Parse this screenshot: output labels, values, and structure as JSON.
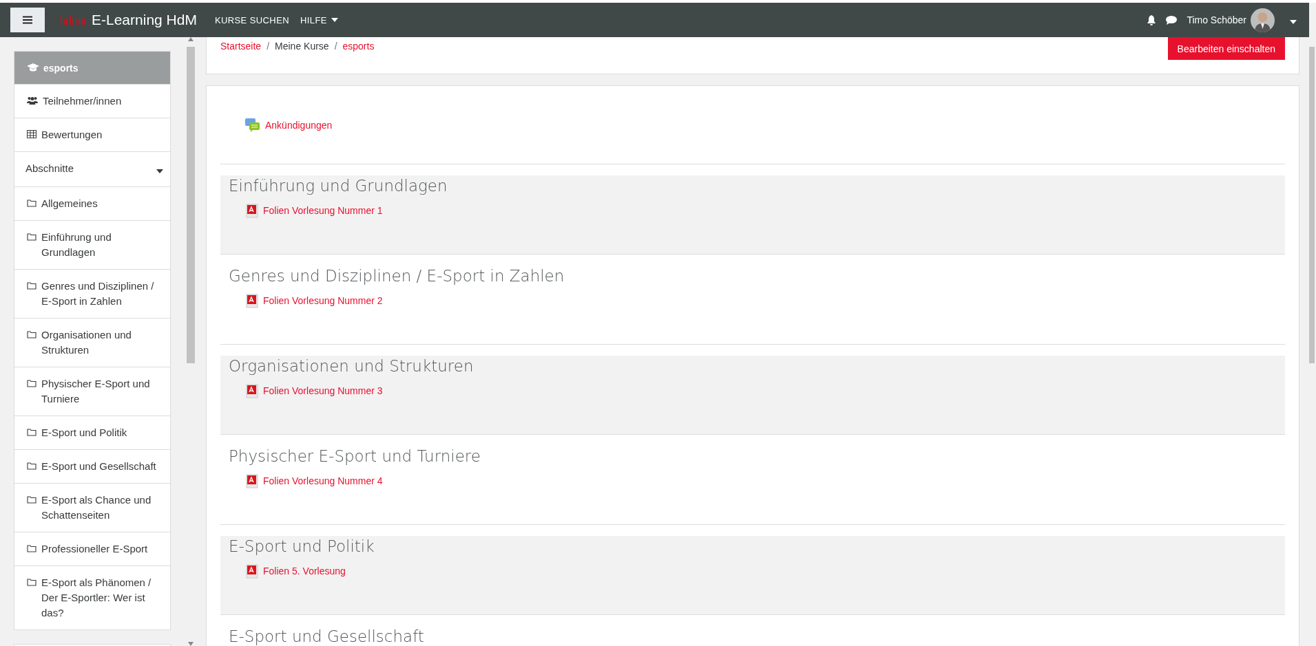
{
  "navbar": {
    "brand": "E-Learning HdM",
    "menu": [
      {
        "label": "KURSE SUCHEN",
        "dropdown": false
      },
      {
        "label": "HILFE",
        "dropdown": true
      }
    ],
    "user": "Timo Schöber"
  },
  "sidebar": {
    "course": "esports",
    "items": [
      {
        "kind": "people",
        "label": "Teilnehmer/innen"
      },
      {
        "kind": "grades",
        "label": "Bewertungen"
      },
      {
        "kind": "toggle",
        "label": "Abschnitte"
      },
      {
        "kind": "folder",
        "label": "Allgemeines"
      },
      {
        "kind": "folder",
        "label": "Einführung und Grundlagen"
      },
      {
        "kind": "folder",
        "label": "Genres und Disziplinen / E-Sport in Zahlen"
      },
      {
        "kind": "folder",
        "label": "Organisationen und Strukturen"
      },
      {
        "kind": "folder",
        "label": "Physischer E-Sport und Turniere"
      },
      {
        "kind": "folder",
        "label": "E-Sport und Politik"
      },
      {
        "kind": "folder",
        "label": "E-Sport und Gesellschaft"
      },
      {
        "kind": "folder",
        "label": "E-Sport als Chance und Schattenseiten"
      },
      {
        "kind": "folder",
        "label": "Professioneller E-Sport"
      },
      {
        "kind": "folder",
        "label": "E-Sport als Phänomen / Der E-Sportler: Wer ist das?"
      }
    ]
  },
  "breadcrumb": [
    {
      "label": "Startseite",
      "link": true
    },
    {
      "separator": "/",
      "label": "Meine Kurse",
      "link": false
    },
    {
      "separator": "/",
      "label": "esports",
      "link": true
    }
  ],
  "edit_button": "Bearbeiten einschalten",
  "announcements": "Ankündigungen",
  "sections": [
    {
      "title": "Einführung und Grundlagen",
      "shaded": true,
      "resource": "Folien Vorlesung Nummer 1"
    },
    {
      "title": "Genres und Disziplinen / E-Sport in Zahlen",
      "shaded": false,
      "resource": "Folien Vorlesung Nummer 2"
    },
    {
      "title": "Organisationen und Strukturen",
      "shaded": true,
      "resource": "Folien Vorlesung Nummer 3"
    },
    {
      "title": "Physischer E-Sport und Turniere",
      "shaded": false,
      "resource": "Folien Vorlesung Nummer 4"
    },
    {
      "title": "E-Sport und Politik",
      "shaded": true,
      "resource": "Folien 5. Vorlesung"
    },
    {
      "title": "E-Sport und Gesellschaft",
      "shaded": false
    }
  ]
}
